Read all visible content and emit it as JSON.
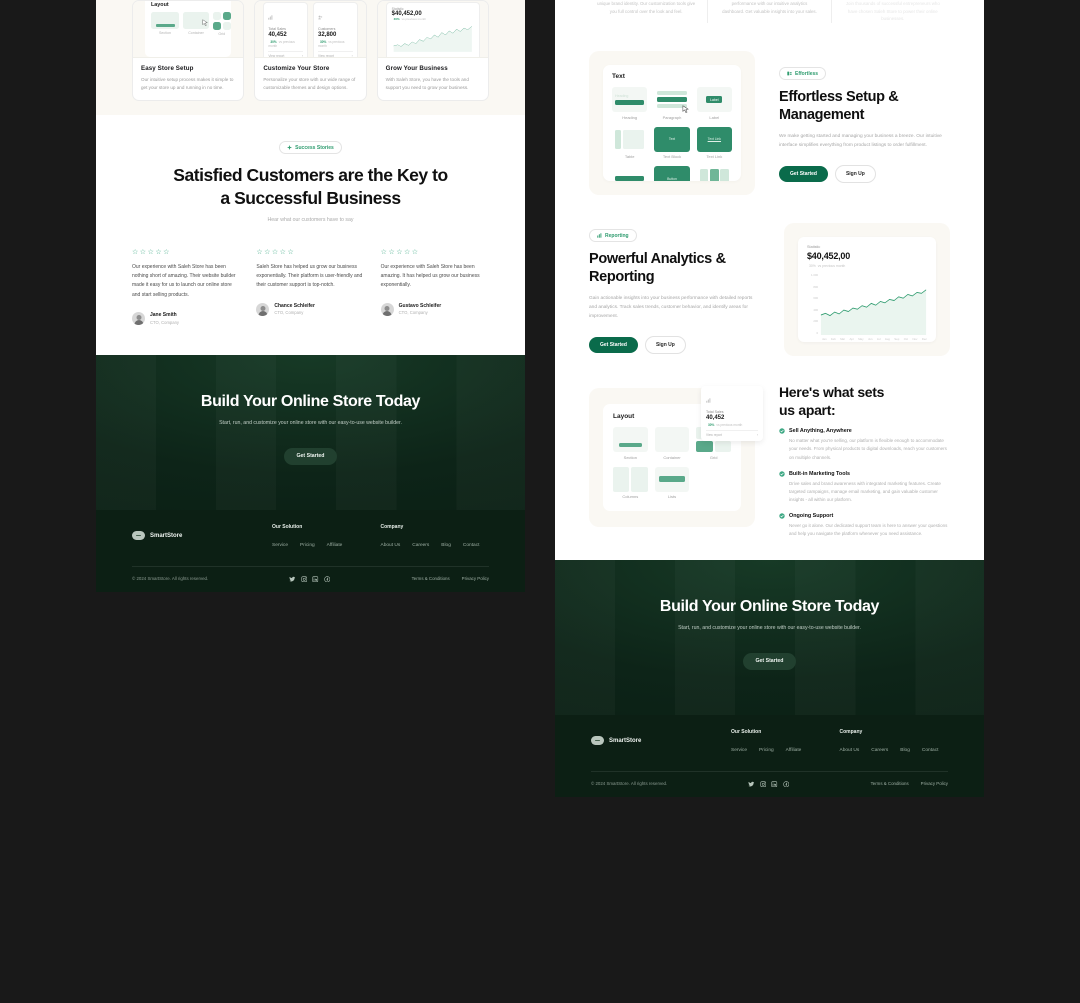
{
  "feature_cards": [
    {
      "title": "Easy Store Setup",
      "desc": "Our intuitive setup process makes it simple to get your store up and running in no time.",
      "visual": "layout-builder"
    },
    {
      "title": "Customize Your Store",
      "desc": "Personalize your store with our wide range of customizable themes and design options.",
      "visual": "stat-cards"
    },
    {
      "title": "Grow Your Business",
      "desc": "With Saleh Store, you have the tools and support you need to grow your business.",
      "visual": "sales-chart"
    }
  ],
  "mini_layout": {
    "title": "Layout",
    "cells": [
      "Section",
      "Container",
      "Grid"
    ]
  },
  "mini_stats": [
    {
      "label": "Total Sales",
      "value": "40,452",
      "delta": "30%",
      "delta_note": "vs previous month",
      "action": "View report"
    },
    {
      "label": "Customers",
      "value": "32,800",
      "delta": "30%",
      "delta_note": "vs previous month",
      "action": "View report"
    }
  ],
  "mini_chart": {
    "label": "Statistic",
    "value": "$40,452,00",
    "delta": "30%",
    "delta_note": "vs previous month"
  },
  "testimonials_section": {
    "badge": "Success Stories",
    "badge_icon": "sparkle-icon",
    "heading_line1": "Satisfied Customers are the Key to",
    "heading_line2": "a Successful Business",
    "subheading": "Hear what our customers have to say",
    "items": [
      {
        "stars": 5,
        "quote": "Our experience with Saleh Store has been nothing short of amazing. Their website builder made it easy for us to launch our online store and start selling products.",
        "name": "Jane Smith",
        "role": "CTO, Company"
      },
      {
        "stars": 5,
        "quote": "Saleh Store has helped us grow our business exponentially. Their platform is user-friendly and their customer support is top-notch.",
        "name": "Chance Schleifer",
        "role": "CTO, Company"
      },
      {
        "stars": 5,
        "quote": "Our experience with Saleh Store has been amazing. It has helped us grow our business exponentially.",
        "name": "Gustavo Schleifer",
        "role": "CTO, Company"
      }
    ]
  },
  "cta": {
    "heading": "Build Your Online Store Today",
    "subtext": "Start, run, and customize your online store with our easy-to-use website builder.",
    "button": "Get Started"
  },
  "footer": {
    "brand": "SmartStore",
    "columns": [
      {
        "title": "Our Solution",
        "links": [
          "Service",
          "Pricing",
          "Affiliate"
        ]
      },
      {
        "title": "Company",
        "links": [
          "About Us",
          "Careers",
          "Blog",
          "Contact"
        ]
      }
    ],
    "copyright": "© 2024 SmartStore. All rights reserved.",
    "legal": [
      "Terms & Conditions",
      "Privacy Policy"
    ],
    "social": [
      "twitter-icon",
      "instagram-icon",
      "linkedin-icon",
      "facebook-icon"
    ]
  },
  "right_top_fade": [
    "unique brand identity. Our customization tools give you full control over the look and feel.",
    "performance with our intuitive analytics dashboard. Get valuable insights into your sales.",
    "Join thousands of successful entrepreneurs who have chosen Saleh Store to power their online businesses."
  ],
  "effortless_section": {
    "badge": "Effortless",
    "badge_icon": "panel-icon",
    "heading": "Effortless Setup & Management",
    "paragraph": "We make getting started and managing your business a breeze. Our intuitive interface simplifies everything from product listings to order fulfillment.",
    "primary_button": "Get Started",
    "secondary_button": "Sign Up",
    "card": {
      "title": "Text",
      "tiles": [
        "Heading",
        "Paragraph",
        "Label",
        "Table",
        "Text Block",
        "Text Link"
      ],
      "tile_inner_labels": {
        "heading": "Heading",
        "label": "Label",
        "text_block": "Text",
        "text_link": "Text Link",
        "button": "Button"
      }
    }
  },
  "reporting_section": {
    "badge": "Reporting",
    "badge_icon": "chart-icon",
    "heading": "Powerful Analytics & Reporting",
    "paragraph": "Gain actionable insights into your business performance with detailed reports and analytics. Track sales trends, customer behavior, and identify areas for improvement.",
    "primary_button": "Get Started",
    "secondary_button": "Sign Up",
    "card": {
      "label": "Statistic",
      "value": "$40,452,00",
      "delta": "30%",
      "delta_note": "vs previous month"
    }
  },
  "apart_section": {
    "heading_line1": "Here's what sets",
    "heading_line2": "us apart:",
    "items": [
      {
        "title": "Sell Anything, Anywhere",
        "desc": "No matter what you're selling, our platform is flexible enough to accommodate your needs. From physical products to digital downloads, reach your customers on multiple channels."
      },
      {
        "title": "Built-in Marketing Tools",
        "desc": "Drive sales and brand awareness with integrated marketing features. Create targeted campaigns, manage email marketing, and gain valuable customer insights - all within our platform."
      },
      {
        "title": "Ongoing Support",
        "desc": "Never go it alone. Our dedicated support team is here to answer your questions and help you navigate the platform whenever you need assistance."
      }
    ],
    "card": {
      "title": "Layout",
      "cells": [
        "Section",
        "Container",
        "Grid",
        "Columns",
        "Lists"
      ],
      "floating_stat": {
        "label": "Total Sales",
        "value": "40,452",
        "delta": "30%",
        "delta_note": "vs previous month",
        "action": "View report"
      }
    }
  },
  "chart_data": {
    "type": "area",
    "title": "Statistic",
    "categories": [
      "Jan",
      "Feb",
      "Mar",
      "Apr",
      "May",
      "Jun",
      "Jul",
      "Aug",
      "Sep",
      "Oct",
      "Nov",
      "Dec"
    ],
    "ytick_labels": [
      "1.000",
      "800",
      "600",
      "400",
      "200",
      "0"
    ],
    "values": [
      310,
      340,
      300,
      360,
      330,
      395,
      370,
      430,
      410,
      470,
      445,
      510,
      480,
      545,
      520,
      580,
      560,
      625,
      600,
      665,
      640,
      700,
      685,
      745
    ],
    "xlabel": "",
    "ylabel": "",
    "ylim": [
      0,
      1000
    ],
    "grid": false,
    "legend": "none",
    "accent": "#2f9c6f"
  },
  "colors": {
    "accent_green": "#0a6b4b",
    "badge_green": "#2f9c6f",
    "dark_green": "#0d2418",
    "footer_green": "#0c1f14",
    "cream": "#faf8f3",
    "page_bg": "#191919"
  }
}
